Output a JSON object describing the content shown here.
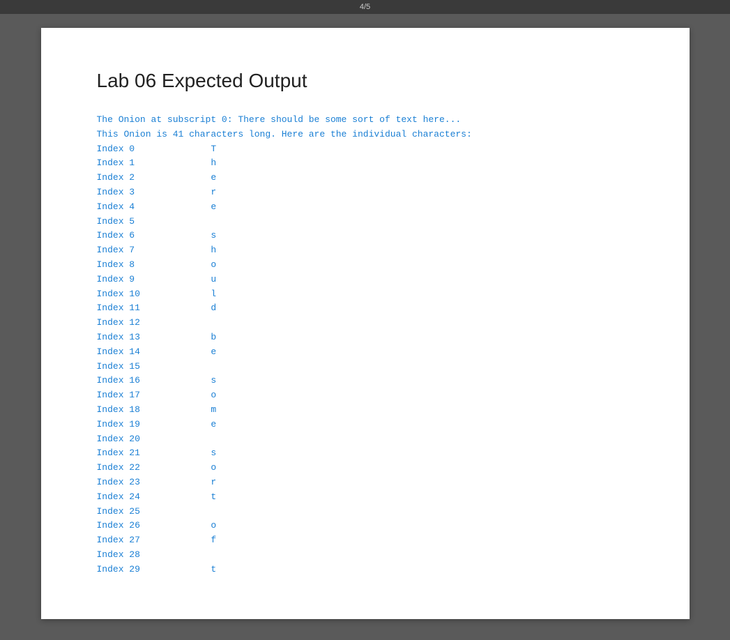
{
  "header": {
    "text": "4/5"
  },
  "page": {
    "title": "Lab 06 Expected Output",
    "code_lines": [
      "The Onion at subscript 0: There should be some sort of text here...",
      "This Onion is 41 characters long. Here are the individual characters:",
      "Index 0              T",
      "Index 1              h",
      "Index 2              e",
      "Index 3              r",
      "Index 4              e",
      "Index 5              ",
      "Index 6              s",
      "Index 7              h",
      "Index 8              o",
      "Index 9              u",
      "Index 10             l",
      "Index 11             d",
      "Index 12             ",
      "Index 13             b",
      "Index 14             e",
      "Index 15             ",
      "Index 16             s",
      "Index 17             o",
      "Index 18             m",
      "Index 19             e",
      "Index 20             ",
      "Index 21             s",
      "Index 22             o",
      "Index 23             r",
      "Index 24             t",
      "Index 25             ",
      "Index 26             o",
      "Index 27             f",
      "Index 28             ",
      "Index 29             t"
    ]
  }
}
